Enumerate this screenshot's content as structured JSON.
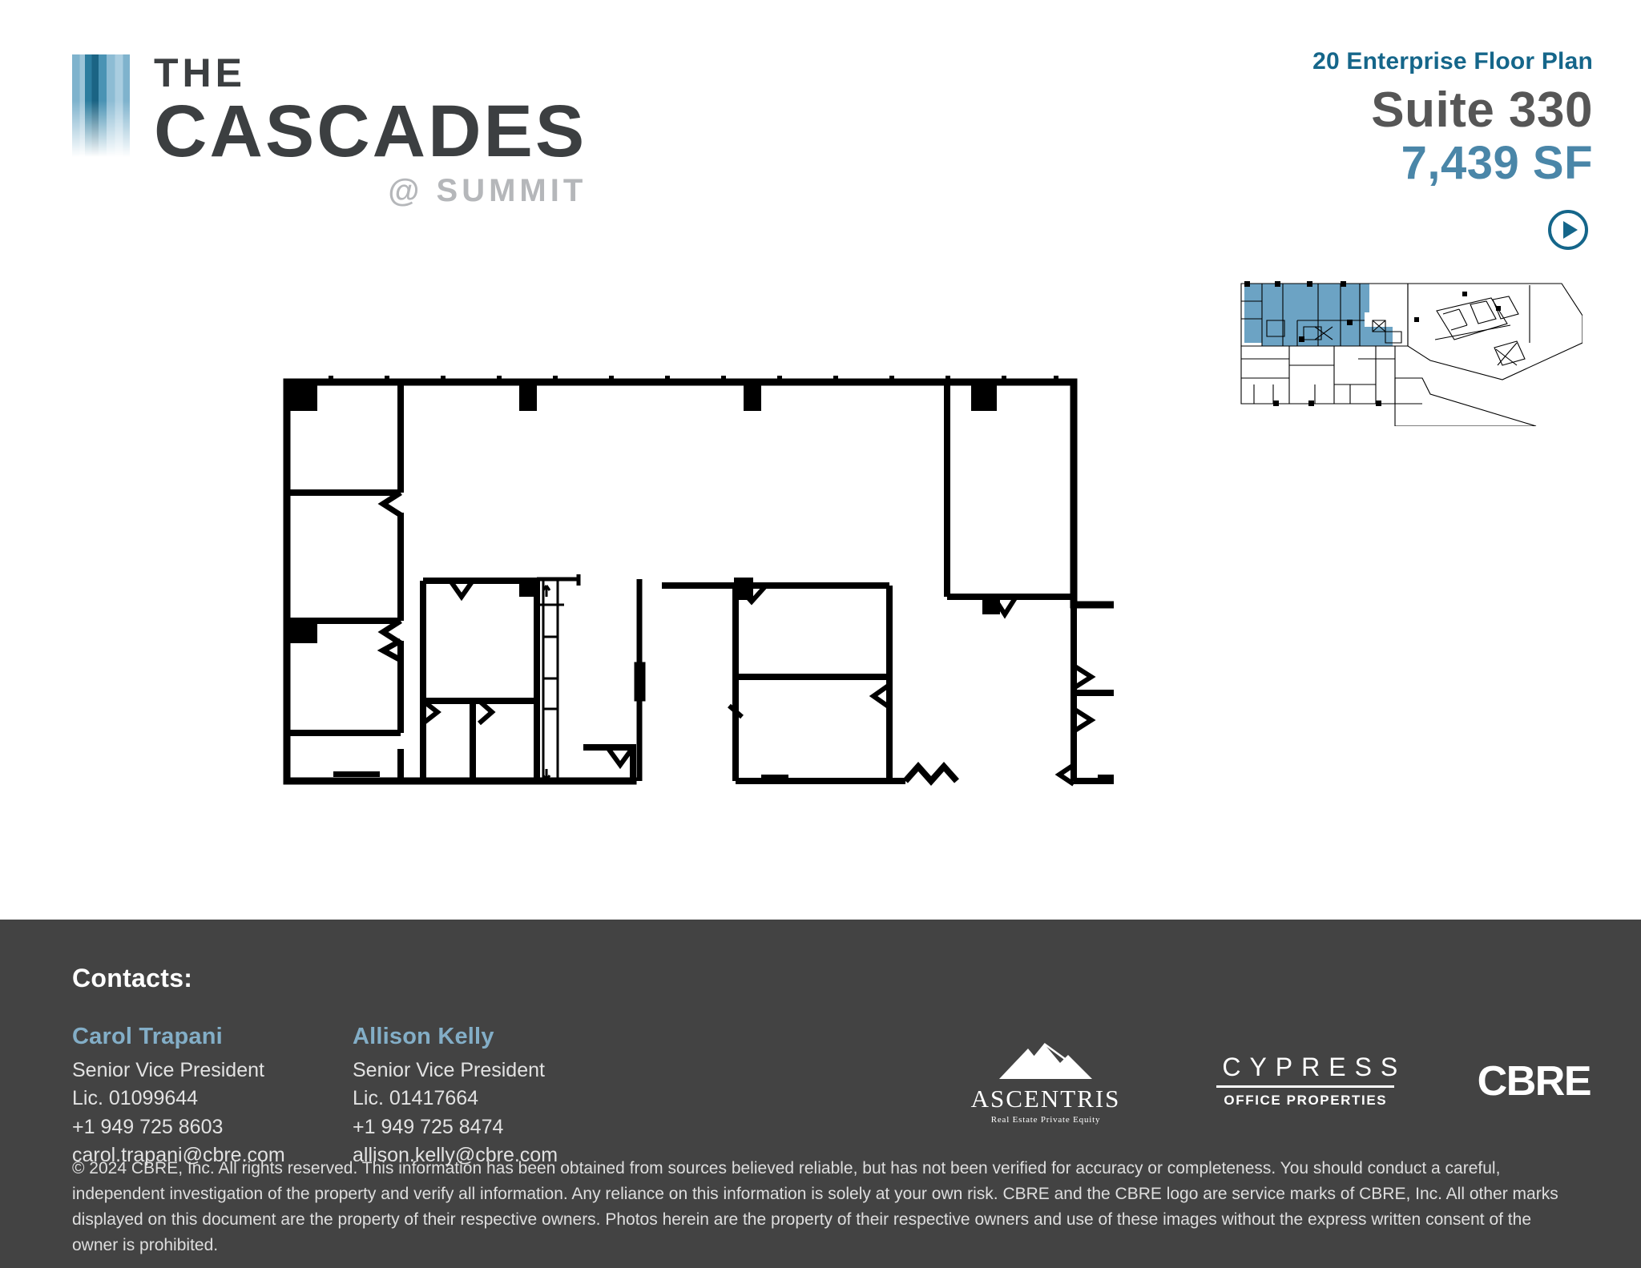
{
  "brand": {
    "the": "THE",
    "name": "CASCADES",
    "subtitle": "@ SUMMIT"
  },
  "header": {
    "floor_plan_label": "20 Enterprise Floor Plan",
    "suite": "Suite 330",
    "area": "7,439 SF",
    "play_button_label": "Play",
    "colors": {
      "floor_plan_label": "#15668a",
      "suite": "#565656",
      "area": "#4a86a8",
      "brand_dark": "#3c3f41",
      "subtitle_gray": "#b5b7ba"
    }
  },
  "keyplan": {
    "highlight_color": "#6ca3c4",
    "stroke_color": "#000000",
    "description": "Building key plan with Suite 330 highlighted"
  },
  "floorplan": {
    "stroke_color": "#000000",
    "description": "Suite 330 floor plan"
  },
  "footer": {
    "contacts_title": "Contacts:",
    "background_color": "#434343",
    "contacts": [
      {
        "name": "Carol Trapani",
        "title": "Senior Vice President",
        "license": "Lic. 01099644",
        "phone": "+1 949 725 8603",
        "email": "carol.trapani@cbre.com"
      },
      {
        "name": "Allison Kelly",
        "title": "Senior Vice President",
        "license": "Lic. 01417664",
        "phone": "+1 949 725 8474",
        "email": "allison.kelly@cbre.com"
      }
    ],
    "logos": {
      "ascentris_name": "ASCENTRIS",
      "ascentris_mark": "™",
      "ascentris_tagline": "Real Estate Private Equity",
      "cypress_name": "CYPRESS",
      "cypress_tagline": "OFFICE PROPERTIES",
      "cbre_name": "CBRE"
    },
    "disclaimer": "© 2024 CBRE, Inc. All rights reserved. This information has been obtained from sources believed reliable, but has not been verified for accuracy or completeness. You should conduct a careful, independent investigation of the property and verify all information. Any reliance on this information is solely at your own risk. CBRE and the CBRE logo are service marks of CBRE, Inc. All other marks displayed on this document are the property of their respective owners. Photos herein are the property of their respective owners and use of these images without the express written consent of the owner is prohibited."
  }
}
